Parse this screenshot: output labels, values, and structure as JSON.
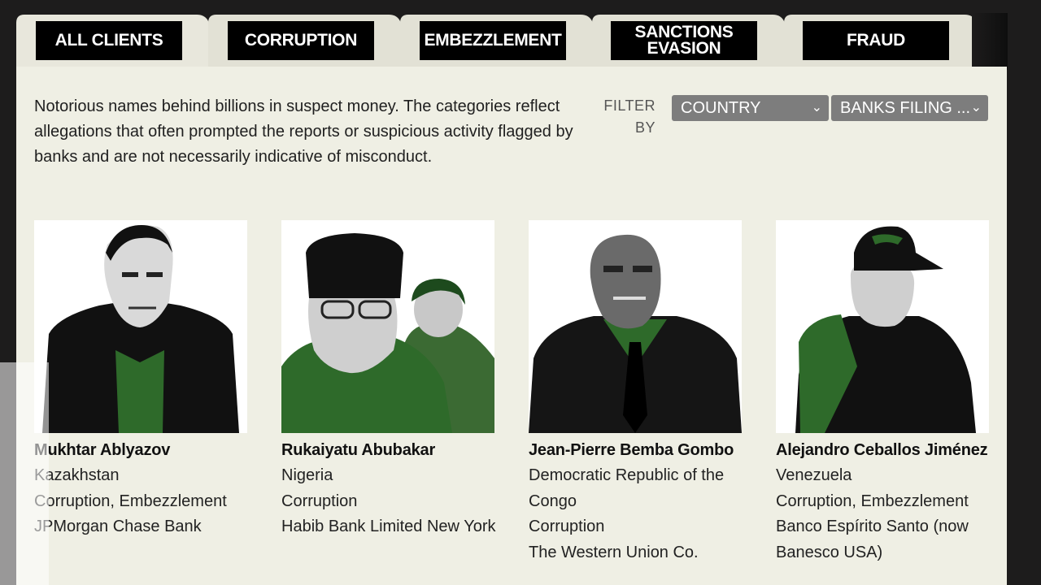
{
  "tabs": [
    {
      "label": "ALL CLIENTS"
    },
    {
      "label": "CORRUPTION"
    },
    {
      "label": "EMBEZZLEMENT"
    },
    {
      "label": "SANCTIONS\nEVASION"
    },
    {
      "label": "FRAUD"
    }
  ],
  "intro": "Notorious names behind billions in suspect money. The categories reflect allegations that often prompted the reports or suspicious activity flagged by banks and are not necessarily indicative of misconduct.",
  "filter": {
    "label": "FILTER BY",
    "country": "COUNTRY",
    "banks": "BANKS FILING ...",
    "chevron_icon": "chevron-down-icon"
  },
  "clients": [
    {
      "name": "Mukhtar Ablyazov",
      "country": "Kazakhstan",
      "categories": "Corruption, Embezzlement",
      "bank": "JPMorgan Chase Bank"
    },
    {
      "name": "Rukaiyatu Abubakar",
      "country": "Nigeria",
      "categories": "Corruption",
      "bank": "Habib Bank Limited New York"
    },
    {
      "name": "Jean-Pierre Bemba Gombo",
      "country": "Democratic Republic of the Congo",
      "categories": "Corruption",
      "bank": "The Western Union Co."
    },
    {
      "name": "Alejandro Ceballos Jiménez",
      "country": "Venezuela",
      "categories": "Corruption, Embezzlement",
      "bank": "Banco Espírito Santo (now Banesco USA)"
    }
  ],
  "colors": {
    "panel": "#efefe4",
    "tab_label_bg": "#000000",
    "accent_green": "#2e6a2a",
    "select_bg": "#7d7d7d"
  }
}
